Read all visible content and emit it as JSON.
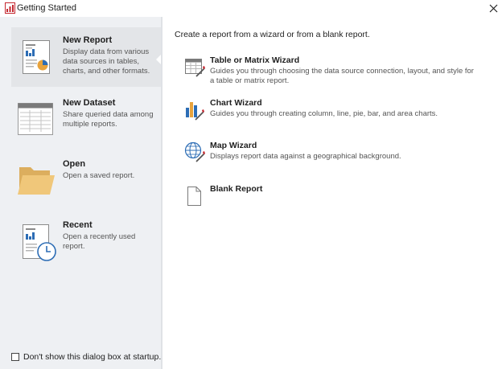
{
  "window": {
    "title": "Getting Started",
    "app_icon": "report-builder-icon",
    "close_icon": "close-icon"
  },
  "sidebar": {
    "items": [
      {
        "label": "New Report",
        "description": "Display data from various data sources in tables, charts, and other formats.",
        "icon": "new-report-icon",
        "selected": true
      },
      {
        "label": "New Dataset",
        "description": "Share queried data among multiple reports.",
        "icon": "new-dataset-icon",
        "selected": false
      },
      {
        "label": "Open",
        "description": "Open a saved report.",
        "icon": "folder-icon",
        "selected": false
      },
      {
        "label": "Recent",
        "description": "Open a recently used report.",
        "icon": "recent-report-icon",
        "selected": false
      }
    ]
  },
  "main": {
    "intro": "Create a report from a wizard or from a blank report.",
    "options": [
      {
        "label": "Table or Matrix Wizard",
        "description": "Guides you through choosing the data source connection, layout, and style for a table or matrix report.",
        "icon": "table-wizard-icon"
      },
      {
        "label": "Chart Wizard",
        "description": "Guides you through creating column, line, pie, bar, and area charts.",
        "icon": "chart-wizard-icon"
      },
      {
        "label": "Map Wizard",
        "description": "Displays report data against a geographical background.",
        "icon": "map-wizard-icon"
      },
      {
        "label": "Blank Report",
        "description": "",
        "icon": "blank-report-icon"
      }
    ]
  },
  "footer": {
    "startup_checkbox_label": "Don't show this dialog box at startup.",
    "startup_checkbox_checked": false
  },
  "colors": {
    "sidebar_bg": "#eef0f3",
    "selected_bg": "#e3e5e8",
    "app_icon_red": "#c4262e",
    "chart_blue": "#2d6db5",
    "chart_orange": "#e8a33c",
    "folder_tan": "#f0c77a"
  }
}
